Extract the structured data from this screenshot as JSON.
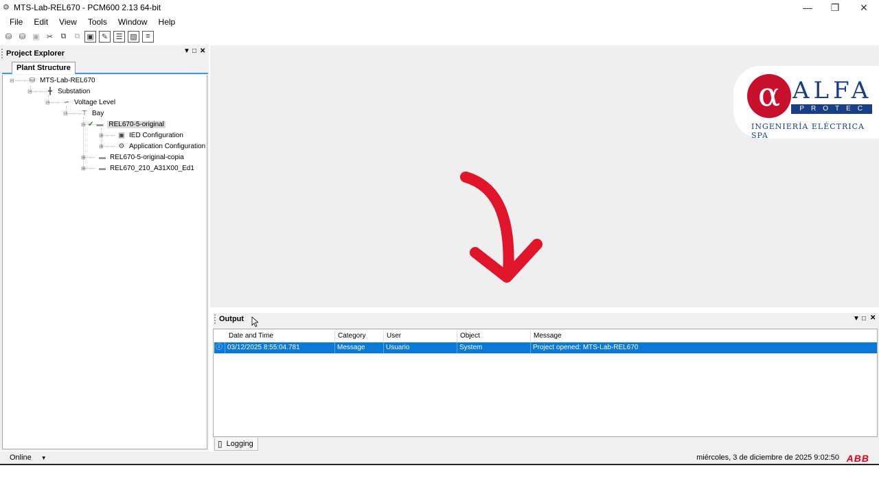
{
  "window": {
    "title": "MTS-Lab-REL670 - PCM600 2.13 64-bit",
    "controls": [
      "minimize",
      "restore",
      "close"
    ]
  },
  "menubar": {
    "items": [
      "File",
      "Edit",
      "View",
      "Tools",
      "Window",
      "Help"
    ]
  },
  "toolbar": {
    "icons": [
      "db-icon",
      "db-add-icon",
      "save-icon",
      "cut-icon",
      "copy-icon",
      "paste-icon",
      "view-1-icon",
      "edit-icon",
      "list-icon",
      "view-2-icon",
      "filter-icon"
    ]
  },
  "project_explorer": {
    "title": "Project Explorer",
    "tab": "Plant Structure",
    "tree": [
      {
        "label": "MTS-Lab-REL670",
        "icon": "database-icon"
      },
      {
        "label": "Substation",
        "icon": "substation-icon"
      },
      {
        "label": "Voltage Level",
        "icon": "voltage-level-icon"
      },
      {
        "label": "Bay",
        "icon": "bay-icon"
      },
      {
        "label": "REL670-5-original",
        "icon": "ied-icon"
      },
      {
        "label": "IED Configuration",
        "icon": "ied-configuration-icon"
      },
      {
        "label": "Application Configuration",
        "icon": "application-configuration-icon"
      },
      {
        "label": "REL670-5-original-copia",
        "icon": "ied-icon"
      },
      {
        "label": "REL670_210_A31X00_Ed1",
        "icon": "ied-icon"
      }
    ]
  },
  "logo": {
    "mark": "α",
    "name": "ALFA",
    "subname": "PROTEC",
    "tagline": "INGENIERÍA ELÉCTRICA SPA",
    "colors": {
      "red": "#c8102e",
      "blue": "#1a3e86"
    }
  },
  "output": {
    "title": "Output",
    "columns": [
      "Date and Time",
      "Category",
      "User",
      "Object",
      "Message"
    ],
    "rows": [
      {
        "datetime": "03/12/2025 8:55:04.781",
        "category": "Message",
        "user": "Usuario",
        "object": "System",
        "message": "Project opened: MTS-Lab-REL670"
      }
    ],
    "tab": "Logging"
  },
  "statusbar": {
    "mode": "Online",
    "datetime": "miércoles, 3 de diciembre de 2025 9:02:50",
    "brand": "ABB"
  },
  "colors": {
    "selection": "#0a78d7",
    "accent_tab": "#3399ff",
    "arrow": "#e0142a",
    "abb_red": "#e2001a"
  }
}
